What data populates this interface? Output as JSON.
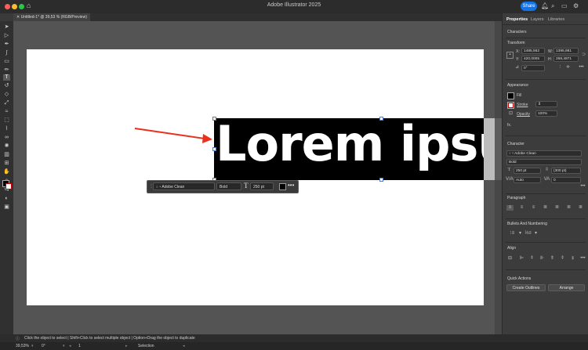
{
  "app_title": "Adobe Illustrator 2025",
  "share_label": "Share",
  "document_tab": "Untitled-1* @ 39,53 % (RGB/Preview)",
  "canvas_text": "Lorem ipsu",
  "context_bar": {
    "font": "Adobe Clean",
    "style": "Bold",
    "size": "250 pt"
  },
  "panel": {
    "tabs": [
      "Properties",
      "Layers",
      "Libraries"
    ],
    "characters_label": "Characters",
    "transform": {
      "title": "Transform",
      "x_label": "X:",
      "x_value": "1485,562",
      "y_label": "Y:",
      "y_value": "420,0005",
      "w_label": "W:",
      "w_value": "1395,981",
      "h_label": "H:",
      "h_value": "268,4971",
      "angle": "0°"
    },
    "appearance": {
      "title": "Appearance",
      "fill_label": "Fill",
      "stroke_label": "Stroke",
      "opacity_label": "Opacity",
      "opacity_value": "100%",
      "fx_label": "fx."
    },
    "character": {
      "title": "Character",
      "font": "Adobe Clean",
      "style": "Bold",
      "size": "250 pt",
      "leading": "(300 pt)",
      "kerning": "Auto",
      "tracking": "0"
    },
    "paragraph_title": "Paragraph",
    "bullets_title": "Bullets And Numbering",
    "align_title": "Align",
    "quick_actions": {
      "title": "Quick Actions",
      "create_outlines": "Create Outlines",
      "arrange": "Arrange"
    }
  },
  "status": {
    "zoom": "39,53%",
    "rotation": "0°",
    "artboard": "1",
    "hint": "Click the object to select  |  Shift+Click to select multiple object  |  Option+Drag the object to duplicate",
    "mode": "Selection"
  },
  "colors": {
    "accent": "#1473e6",
    "annotation_arrow": "#e8321e",
    "canvas_bg": "#545454",
    "text_frame_fill": "#000000"
  }
}
